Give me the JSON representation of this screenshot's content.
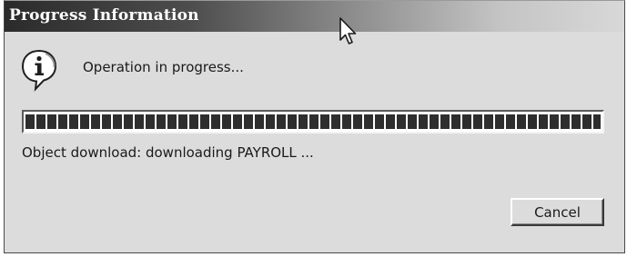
{
  "window": {
    "title": "Progress Information"
  },
  "message": {
    "icon": "info-icon",
    "text": "Operation in progress..."
  },
  "progress": {
    "fraction": 1.0
  },
  "status": {
    "text": "Object download: downloading PAYROLL ..."
  },
  "buttons": {
    "cancel_label": "Cancel"
  },
  "colors": {
    "dialog_background": "#dcdcdc",
    "progress_block": "#2e2e2e",
    "title_text": "#ffffff"
  }
}
